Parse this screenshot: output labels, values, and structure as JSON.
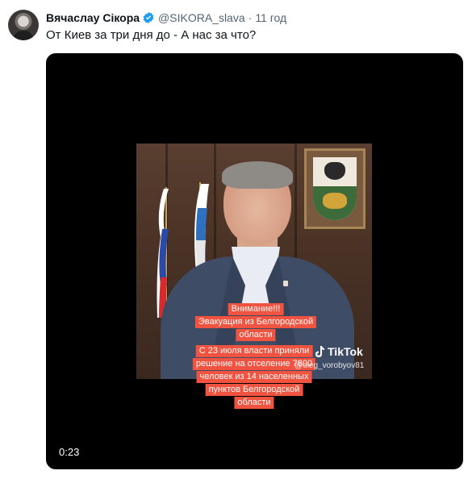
{
  "author": {
    "display_name": "Вячаслау Сiкора",
    "handle": "@SIKORA_slava",
    "time_ago": "11 год",
    "verified": true,
    "verified_color": "#1d9bf0"
  },
  "tweet": {
    "text": "От Киев за три дня до - А нас за что?"
  },
  "video": {
    "timecode": "0:23",
    "tiktok_label": "TikTok",
    "tiktok_user": "@oleg_vorobyov81",
    "caption_lines": [
      "Внимание!!!",
      "Эвакуация из Белгородской",
      "области",
      "С 23 июля власти приняли",
      "решение на отселение 7800",
      "человек из 14 населенных",
      "пунктов Белгородской",
      "области"
    ],
    "caption_color": "#f0533f"
  }
}
